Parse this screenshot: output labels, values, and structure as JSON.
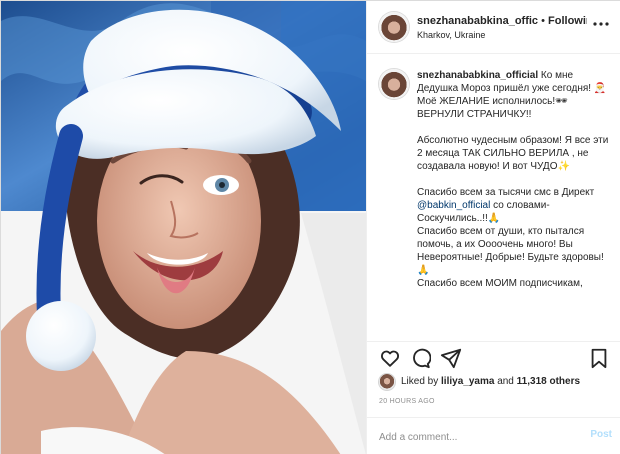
{
  "post": {
    "header": {
      "username": "snezhanababkina_offic",
      "separator": "•",
      "follow_label": "Following",
      "location": "Kharkov, Ukraine",
      "more_icon": "more-horizontal-icon"
    },
    "caption": {
      "username": "snezhanababkina_official",
      "text_part1": " Ко мне Дедушка Мороз пришёл уже сегодня! 🎅 Моё ЖЕЛАНИЕ исполнилось!🕶\nВЕРНУЛИ СТРАНИЧКУ!!\n\nАбсолютно чудесным образом! Я все эти 2 месяца ТАК СИЛЬНО ВЕРИЛА , не создавала новую! И вот ЧУДО✨\n\nСпасибо всем за тысячи смс в Директ ",
      "mention": "@babkin_official",
      "text_part2": " со словами- Соскучились..!!🙏\nСпасибо всем от души, кто пытался помочь, а их Оооочень много! Вы Невероятные! Добрые! Будьте здоровы!🙏\nСпасибо всем МОИМ подписчикам,"
    },
    "actions": {
      "like_icon": "heart-icon",
      "comment_icon": "comment-icon",
      "share_icon": "paper-plane-icon",
      "save_icon": "bookmark-icon"
    },
    "likes": {
      "prefix": "Liked by",
      "liked_user": "liliya_yama",
      "connector": "and",
      "others": "11,318 others"
    },
    "timestamp": "20 HOURS AGO",
    "comment": {
      "placeholder": "Add a comment...",
      "post_label": "Post"
    }
  },
  "colors": {
    "wall_blue": "#2f67b4",
    "santa_hat_blue": "#1d4ba5",
    "fur_white": "#f6fbff",
    "mention_blue": "#00376b",
    "post_disabled": "#b2dffc",
    "divider": "#efefef"
  }
}
